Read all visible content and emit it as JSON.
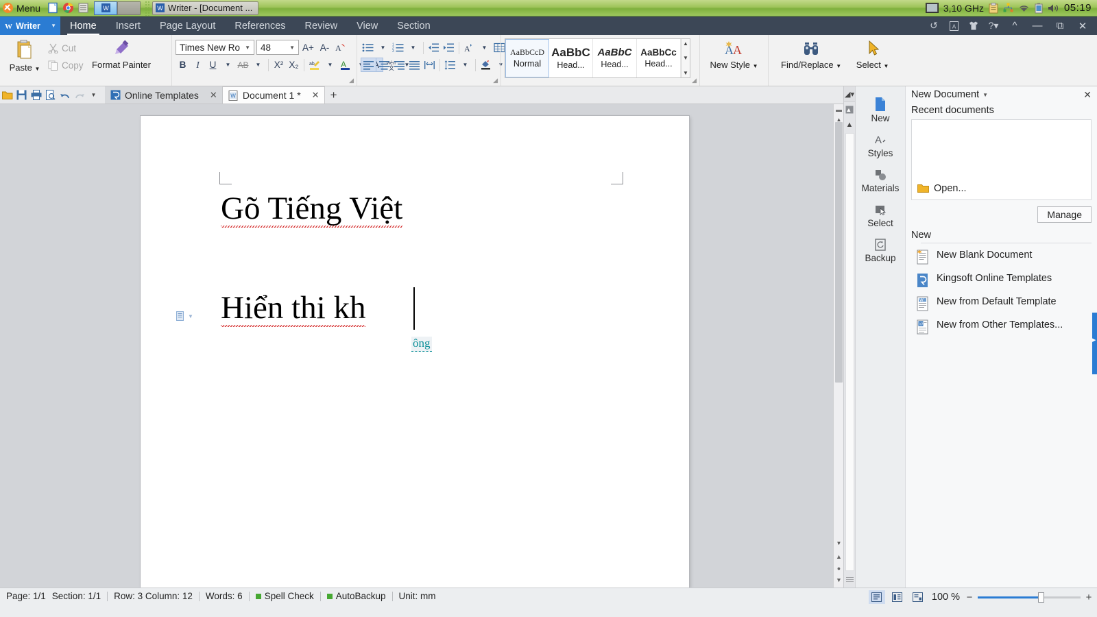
{
  "taskbar": {
    "menu_label": "Menu",
    "launchers": [
      "files-icon",
      "chrome-icon",
      "archive-icon"
    ],
    "window_buttons": [
      "writer-window-button",
      "empty-window-button"
    ],
    "active_task": "Writer - [Document ...",
    "tray": {
      "cpu": "3,10 GHz",
      "icons": [
        "clipboard-icon",
        "network-icon",
        "wifi-icon",
        "battery-icon",
        "volume-icon"
      ],
      "clock": "05:19"
    }
  },
  "ribbon": {
    "app_name": "Writer",
    "tabs": [
      {
        "label": "Home",
        "active": true
      },
      {
        "label": "Insert",
        "active": false
      },
      {
        "label": "Page Layout",
        "active": false
      },
      {
        "label": "References",
        "active": false
      },
      {
        "label": "Review",
        "active": false
      },
      {
        "label": "View",
        "active": false
      },
      {
        "label": "Section",
        "active": false
      }
    ],
    "right_icons": [
      "refresh-icon",
      "document-icon",
      "shirt-icon",
      "help-icon"
    ],
    "window_controls": [
      "collapse-ribbon-icon",
      "minimize-icon",
      "restore-icon",
      "close-icon"
    ],
    "clipboard": {
      "paste": "Paste",
      "cut": "Cut",
      "copy": "Copy",
      "format_painter": "Format Painter"
    },
    "font": {
      "family_value": "Times New Ro",
      "size_value": "48",
      "grow": "A+",
      "shrink": "A-",
      "clear_format": "clear-formatting-icon",
      "bold": "B",
      "italic": "I",
      "underline": "U",
      "strikethrough": "AB",
      "superscript": "X²",
      "subscript": "X₂",
      "highlight": "highlight-icon",
      "font_color": "font-color-icon",
      "char_shading": "A",
      "phonetic": "phonetic-guide-icon"
    },
    "styles": {
      "items": [
        {
          "preview": "AaBbCcD",
          "name": "Normal",
          "selected": true
        },
        {
          "preview": "AaBbC",
          "name": "Head...",
          "selected": false
        },
        {
          "preview": "AaBbC",
          "name": "Head...",
          "selected": false
        },
        {
          "preview": "AaBbCc",
          "name": "Head...",
          "selected": false
        }
      ],
      "new_style": "New Style",
      "find_replace": "Find/Replace",
      "select": "Select"
    }
  },
  "tabbar": {
    "quick_access": [
      "open-icon",
      "save-icon",
      "print-icon",
      "print-preview-icon",
      "undo-icon",
      "redo-icon",
      "customize-icon"
    ],
    "tabs": [
      {
        "label": "Online Templates",
        "icon": "templates-icon",
        "active": false
      },
      {
        "label": "Document 1 *",
        "icon": "writer-doc-icon",
        "active": true
      }
    ],
    "new_tab": "+"
  },
  "document": {
    "lines": [
      {
        "text": "Gõ Tiếng Việt",
        "spellchecked": true
      },
      {
        "text": "Hiển thi kh",
        "spellchecked": true
      }
    ],
    "ime_suggestion": "ông"
  },
  "taskpane": {
    "title": "New Document",
    "nav": [
      {
        "label": "New",
        "icon": "new-doc-icon"
      },
      {
        "label": "Styles",
        "icon": "styles-icon"
      },
      {
        "label": "Materials",
        "icon": "materials-icon"
      },
      {
        "label": "Select",
        "icon": "select-icon"
      },
      {
        "label": "Backup",
        "icon": "backup-icon"
      }
    ],
    "recent_label": "Recent documents",
    "open_label": "Open...",
    "manage_label": "Manage",
    "new_label": "New",
    "new_items": [
      {
        "label": "New Blank Document",
        "icon": "blank-document-icon"
      },
      {
        "label": "Kingsoft Online Templates",
        "icon": "kingsoft-templates-icon"
      },
      {
        "label": "New from Default Template",
        "icon": "default-template-icon"
      },
      {
        "label": "New from Other Templates...",
        "icon": "other-templates-icon"
      }
    ]
  },
  "statusbar": {
    "page": "Page: 1/1",
    "section": "Section: 1/1",
    "row_col": "Row: 3 Column: 12",
    "words": "Words: 6",
    "spell_check": "Spell Check",
    "autobackup": "AutoBackup",
    "unit": "Unit: mm",
    "zoom": "100 %",
    "view_modes": [
      "print-layout-icon",
      "full-screen-icon",
      "web-layout-icon"
    ]
  },
  "colors": {
    "accent": "#2b7cd3",
    "ribbon_bg": "#3c4756",
    "taskbar_green": "#9ec45a",
    "spell_red": "#d42a2a",
    "ime_teal": "#0b8f98"
  }
}
